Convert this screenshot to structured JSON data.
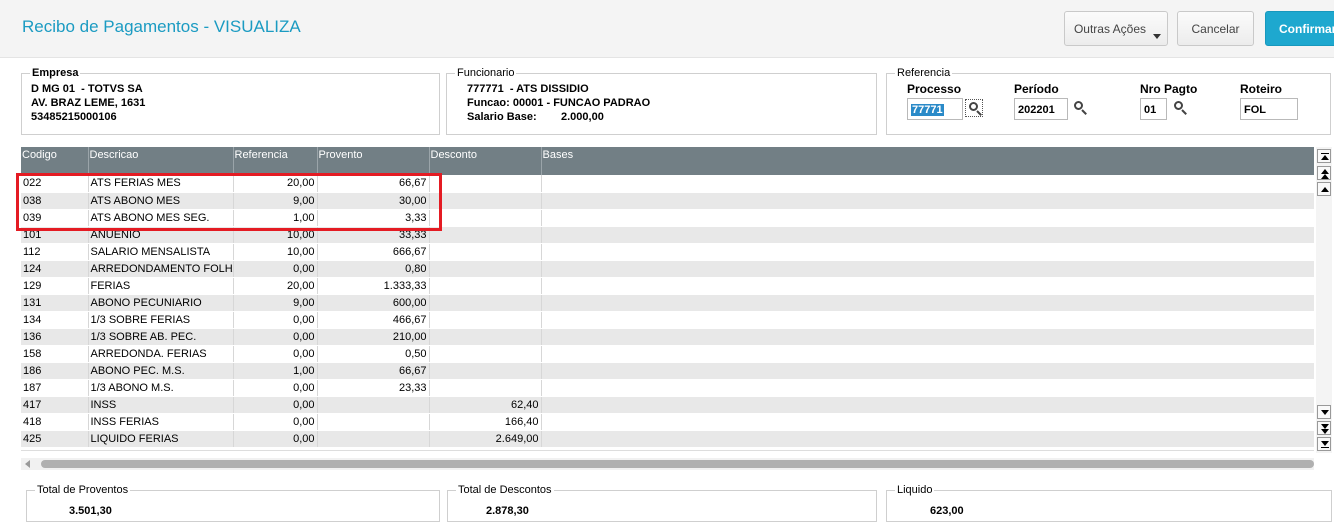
{
  "header": {
    "title": "Recibo de Pagamentos - VISUALIZA",
    "outras_acoes": "Outras Ações",
    "cancelar": "Cancelar",
    "confirmar": "Confirmar"
  },
  "empresa": {
    "legend": "Empresa",
    "line1": "D MG 01  - TOTVS SA",
    "line2": "AV. BRAZ LEME, 1631",
    "line3": "53485215000106"
  },
  "funcionario": {
    "legend": "Funcionario",
    "line1": "777771  - ATS DISSIDIO",
    "line2": "Funcao: 00001 - FUNCAO PADRAO",
    "salario_label": "Salario Base:",
    "salario_value": "2.000,00"
  },
  "referencia": {
    "legend": "Referencia",
    "processo_label": "Processo",
    "processo_value": "77771",
    "periodo_label": "Período",
    "periodo_value": "202201",
    "nro_pagto_label": "Nro Pagto",
    "nro_pagto_value": "01",
    "roteiro_label": "Roteiro",
    "roteiro_value": "FOL"
  },
  "grid": {
    "columns": [
      "Codigo",
      "Descricao",
      "Referencia",
      "Provento",
      "Desconto",
      "Bases"
    ],
    "rows": [
      [
        "022",
        "ATS FERIAS MES",
        "20,00",
        "66,67",
        "",
        ""
      ],
      [
        "038",
        "ATS ABONO MES",
        "9,00",
        "30,00",
        "",
        ""
      ],
      [
        "039",
        "ATS ABONO MES SEG.",
        "1,00",
        "3,33",
        "",
        ""
      ],
      [
        "101",
        "ANUENIO",
        "10,00",
        "33,33",
        "",
        ""
      ],
      [
        "112",
        "SALARIO MENSALISTA",
        "10,00",
        "666,67",
        "",
        ""
      ],
      [
        "124",
        "ARREDONDAMENTO FOLHA",
        "0,00",
        "0,80",
        "",
        ""
      ],
      [
        "129",
        "FERIAS",
        "20,00",
        "1.333,33",
        "",
        ""
      ],
      [
        "131",
        "ABONO PECUNIARIO",
        "9,00",
        "600,00",
        "",
        ""
      ],
      [
        "134",
        "1/3 SOBRE FERIAS",
        "0,00",
        "466,67",
        "",
        ""
      ],
      [
        "136",
        "1/3 SOBRE AB. PEC.",
        "0,00",
        "210,00",
        "",
        ""
      ],
      [
        "158",
        "ARREDONDA. FERIAS",
        "0,00",
        "0,50",
        "",
        ""
      ],
      [
        "186",
        "ABONO PEC. M.S.",
        "1,00",
        "66,67",
        "",
        ""
      ],
      [
        "187",
        "1/3 ABONO M.S.",
        "0,00",
        "23,33",
        "",
        ""
      ],
      [
        "417",
        "INSS",
        "0,00",
        "",
        "62,40",
        ""
      ],
      [
        "418",
        "INSS FERIAS",
        "0,00",
        "",
        "166,40",
        ""
      ],
      [
        "425",
        "LIQUIDO FERIAS",
        "0,00",
        "",
        "2.649,00",
        ""
      ]
    ]
  },
  "totals": {
    "proventos_label": "Total de Proventos",
    "proventos_value": "3.501,30",
    "descontos_label": "Total de Descontos",
    "descontos_value": "2.878,30",
    "liquido_label": "Liquido",
    "liquido_value": "623,00"
  },
  "colors": {
    "accent": "#1ea8cf",
    "title": "#1b9bc2",
    "grid_header": "#727f85",
    "highlight": "#e41b23"
  }
}
